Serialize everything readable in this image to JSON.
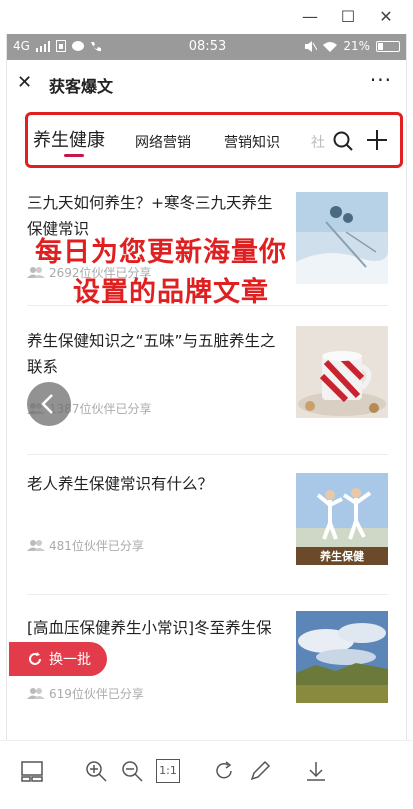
{
  "window": {
    "minimize_glyph": "—",
    "maximize_glyph": "☐",
    "close_glyph": "✕"
  },
  "status_bar": {
    "network": "4G",
    "time": "08:53",
    "battery": "21%",
    "background": "#9a9a9a"
  },
  "header": {
    "close_glyph": "✕",
    "title": "获客爆文",
    "more_glyph": "···"
  },
  "tabs": {
    "items": [
      {
        "label": "养生健康",
        "active": true
      },
      {
        "label": "网络营销",
        "active": false
      },
      {
        "label": "营销知识",
        "active": false
      },
      {
        "label": "社",
        "active": false
      }
    ],
    "highlight_color": "#e02020",
    "active_underline_color": "#c7164a"
  },
  "promo": {
    "line1": "每日为您更新海量你",
    "line2": "设置的品牌文章",
    "color": "#e02020"
  },
  "articles": [
    {
      "title": "三九天如何养生？+寒冬三九天养生保健常识",
      "shares": "2692位伙伴已分享",
      "thumb": "snow-winter-image"
    },
    {
      "title": "养生保健知识之“五味”与五脏养生之联系",
      "shares": "1387位伙伴已分享",
      "thumb": "cup-dessert-image"
    },
    {
      "title": "老人养生保健常识有什么？",
      "shares": "481位伙伴已分享",
      "thumb": "elderly-exercise-image",
      "thumb_caption": "养生保健"
    },
    {
      "title": "[高血压保健养生小常识]冬至养生保健常识",
      "shares": "619位伙伴已分享",
      "thumb": "landscape-sky-image"
    }
  ],
  "buttons": {
    "refresh_label": "换一批",
    "refresh_color": "#e23b4a"
  },
  "toolbar": {
    "items": [
      "thumbnail-view-icon",
      "zoom-in-icon",
      "zoom-out-icon",
      "actual-size-icon",
      "rotate-icon",
      "edit-icon",
      "download-icon"
    ],
    "actual_size_label": "1:1"
  }
}
